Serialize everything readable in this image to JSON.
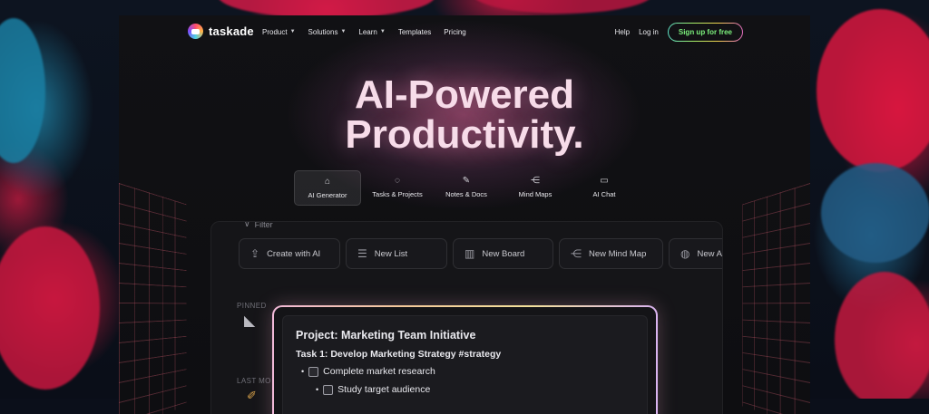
{
  "nav": {
    "logo_text": "taskade",
    "menu": [
      {
        "label": "Product",
        "has_dropdown": true
      },
      {
        "label": "Solutions",
        "has_dropdown": true
      },
      {
        "label": "Learn",
        "has_dropdown": true
      },
      {
        "label": "Templates",
        "has_dropdown": false
      },
      {
        "label": "Pricing",
        "has_dropdown": false
      }
    ],
    "help": "Help",
    "login": "Log in",
    "signup": "Sign up for free"
  },
  "hero": {
    "line1": "AI-Powered",
    "line2": "Productivity."
  },
  "tabs": [
    {
      "label": "AI Generator",
      "icon": "robot-icon",
      "active": true
    },
    {
      "label": "Tasks & Projects",
      "icon": "check-circle-icon",
      "active": false
    },
    {
      "label": "Notes & Docs",
      "icon": "pen-icon",
      "active": false
    },
    {
      "label": "Mind Maps",
      "icon": "share-nodes-icon",
      "active": false
    },
    {
      "label": "AI Chat",
      "icon": "video-icon",
      "active": false
    }
  ],
  "panel": {
    "filter": "Filter",
    "quick_actions": [
      {
        "label": "Create with AI",
        "icon": "upload-icon"
      },
      {
        "label": "New List",
        "icon": "list-icon"
      },
      {
        "label": "New Board",
        "icon": "board-icon"
      },
      {
        "label": "New Mind Map",
        "icon": "mindmap-icon"
      },
      {
        "label": "New A",
        "icon": "globe-icon"
      }
    ],
    "pinned_label": "PINNED",
    "last_label": "LAST MO"
  },
  "card": {
    "title": "Project: Marketing Team Initiative",
    "task": "Task 1: Develop Marketing Strategy #strategy",
    "items": [
      {
        "text": "Complete market research",
        "level": 1
      },
      {
        "text": "Study target audience",
        "level": 2
      }
    ]
  },
  "colors": {
    "accent_green": "#7cf07c",
    "hero_pink": "#f7dce9",
    "panel_bg": "#151518"
  }
}
